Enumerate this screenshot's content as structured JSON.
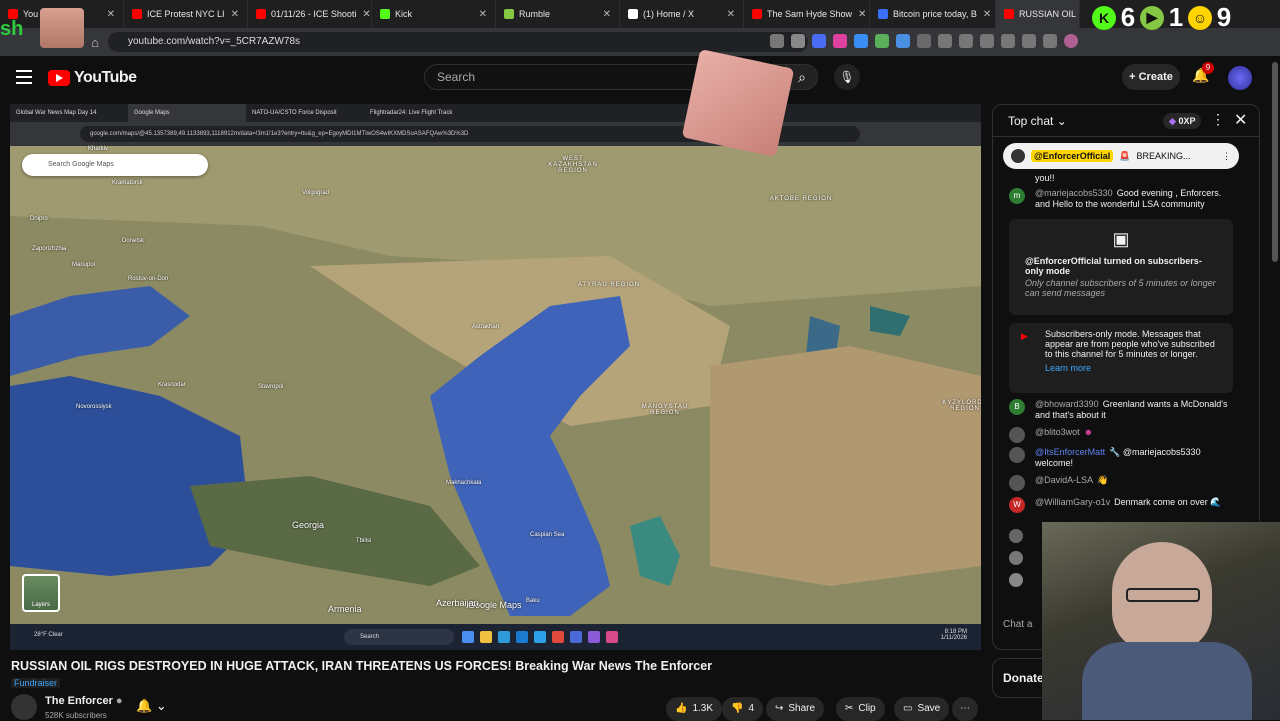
{
  "browser": {
    "tabs": [
      {
        "label": "You",
        "color": "#ff0000"
      },
      {
        "label": "ICE Protest NYC LI",
        "color": "#ff0000"
      },
      {
        "label": "01/11/26 - ICE Shooti",
        "color": "#ff0000"
      },
      {
        "label": "Kick",
        "color": "#53fc18"
      },
      {
        "label": "Rumble",
        "color": "#85c742"
      },
      {
        "label": "(1) Home / X",
        "color": "#ffffff"
      },
      {
        "label": "The Sam Hyde Show",
        "color": "#ff0000"
      },
      {
        "label": "Bitcoin price today, B",
        "color": "#3a6ff7"
      },
      {
        "label": "RUSSIAN OIL",
        "color": "#ff0000"
      }
    ],
    "url": "youtube.com/watch?v=_5CR7AZW78s"
  },
  "overlay": {
    "sh_text": "sh",
    "counters": [
      {
        "label": "K",
        "value": "6",
        "color": "#53fc18"
      },
      {
        "label": "▶",
        "value": "1",
        "color": "#85c742"
      },
      {
        "label": "☺",
        "value": "9",
        "color": "#ffd400"
      }
    ]
  },
  "youtube": {
    "logo_text": "YouTube",
    "search_placeholder": "Search",
    "create_label": "Create",
    "notif_count": "9"
  },
  "screen_share": {
    "tabs": [
      "Global War News Map Day 14",
      "Google Maps",
      "NATO-UA/CSTO Force Disposit",
      "Flightradar24: Live Flight Track"
    ],
    "url": "google.com/maps/@45.1357389,49.1133893,1118912m/data=!3m1!1e3?entry=ttu&g_ep=EgoyMDI1MTIwOS4wIKXMDSoASAFQAw%3D%3D",
    "map_search_placeholder": "Search Google Maps",
    "layers_label": "Layers",
    "map_brand": "Google Maps",
    "map_labels": [
      {
        "text": "Kharkiv",
        "kind": "city"
      },
      {
        "text": "Kramatorsk",
        "kind": "city"
      },
      {
        "text": "Dnipro",
        "kind": "city"
      },
      {
        "text": "Donetsk",
        "kind": "city"
      },
      {
        "text": "Zaporizhzhia",
        "kind": "city"
      },
      {
        "text": "Mariupol",
        "kind": "city"
      },
      {
        "text": "Rostov-on-Don",
        "kind": "city"
      },
      {
        "text": "Volgograd",
        "kind": "city"
      },
      {
        "text": "Krasnodar",
        "kind": "city"
      },
      {
        "text": "Stavropol",
        "kind": "city"
      },
      {
        "text": "Novorossiysk",
        "kind": "city"
      },
      {
        "text": "Georgia",
        "kind": "country"
      },
      {
        "text": "Tbilisi",
        "kind": "city"
      },
      {
        "text": "Armenia",
        "kind": "country"
      },
      {
        "text": "Azerbaijan",
        "kind": "country"
      },
      {
        "text": "Baku",
        "kind": "city"
      },
      {
        "text": "Astrakhan",
        "kind": "city"
      },
      {
        "text": "Makhachkala",
        "kind": "city"
      },
      {
        "text": "Caspian Sea",
        "kind": "sea"
      },
      {
        "text": "WEST KAZAKHSTAN REGION",
        "kind": "region"
      },
      {
        "text": "AKTOBE REGION",
        "kind": "region"
      },
      {
        "text": "ATYRAU REGION",
        "kind": "region"
      },
      {
        "text": "MANGYSTAU REGION",
        "kind": "region"
      },
      {
        "text": "KYZYLORDA REGION",
        "kind": "region"
      }
    ],
    "taskbar": {
      "weather": "28°F Clear",
      "search": "Search",
      "time": "8:18 PM",
      "date": "1/11/2026"
    }
  },
  "video": {
    "title": "RUSSIAN OIL RIGS DESTROYED IN HUGE ATTACK, IRAN THREATENS US FORCES! Breaking War News The Enforcer",
    "fundraiser": "Fundraiser",
    "channel": "The Enforcer",
    "subscribers": "528K subscribers",
    "likes": "1.3K",
    "dislikes": "4",
    "share": "Share",
    "clip": "Clip",
    "save": "Save"
  },
  "chat": {
    "title": "Top chat",
    "xp_badge": "0XP",
    "pinned_author": "@EnforcerOfficial",
    "pinned_text": "BREAKING...",
    "messages": [
      {
        "author": "",
        "text": "you!!",
        "avatar": "",
        "color": "#333333"
      },
      {
        "author": "@mariejacobs5330",
        "text": "Good evening , Enforcers. and Hello to the wonderful LSA community",
        "avatar": "m",
        "color": "#2e7d32"
      },
      {
        "author": "@bhoward3390",
        "text": "Greenland wants a McDonald's and that's about it",
        "avatar": "B",
        "color": "#2e7d32"
      },
      {
        "author": "@blito3wot",
        "text": "",
        "avatar": "",
        "color": "#555555"
      },
      {
        "author": "@ItsEnforcerMatt",
        "text": "@mariejacobs5330 welcome!",
        "avatar": "",
        "color": "#555555"
      },
      {
        "author": "@DavidA-LSA",
        "text": "",
        "avatar": "",
        "color": "#555555"
      },
      {
        "author": "@WilliamGary-o1v",
        "text": "Denmark come on over",
        "avatar": "W",
        "color": "#c62828"
      }
    ],
    "sub_mode_title": "@EnforcerOfficial turned on subscribers-only mode",
    "sub_mode_sub": "Only channel subscribers of 5 minutes or longer can send messages",
    "sub_mode_notice": "Subscribers-only mode. Messages that appear are from people who've subscribed to this channel for 5 minutes or longer.",
    "learn_more": "Learn more",
    "input_placeholder": "Chat a",
    "donate_label": "Donate"
  }
}
